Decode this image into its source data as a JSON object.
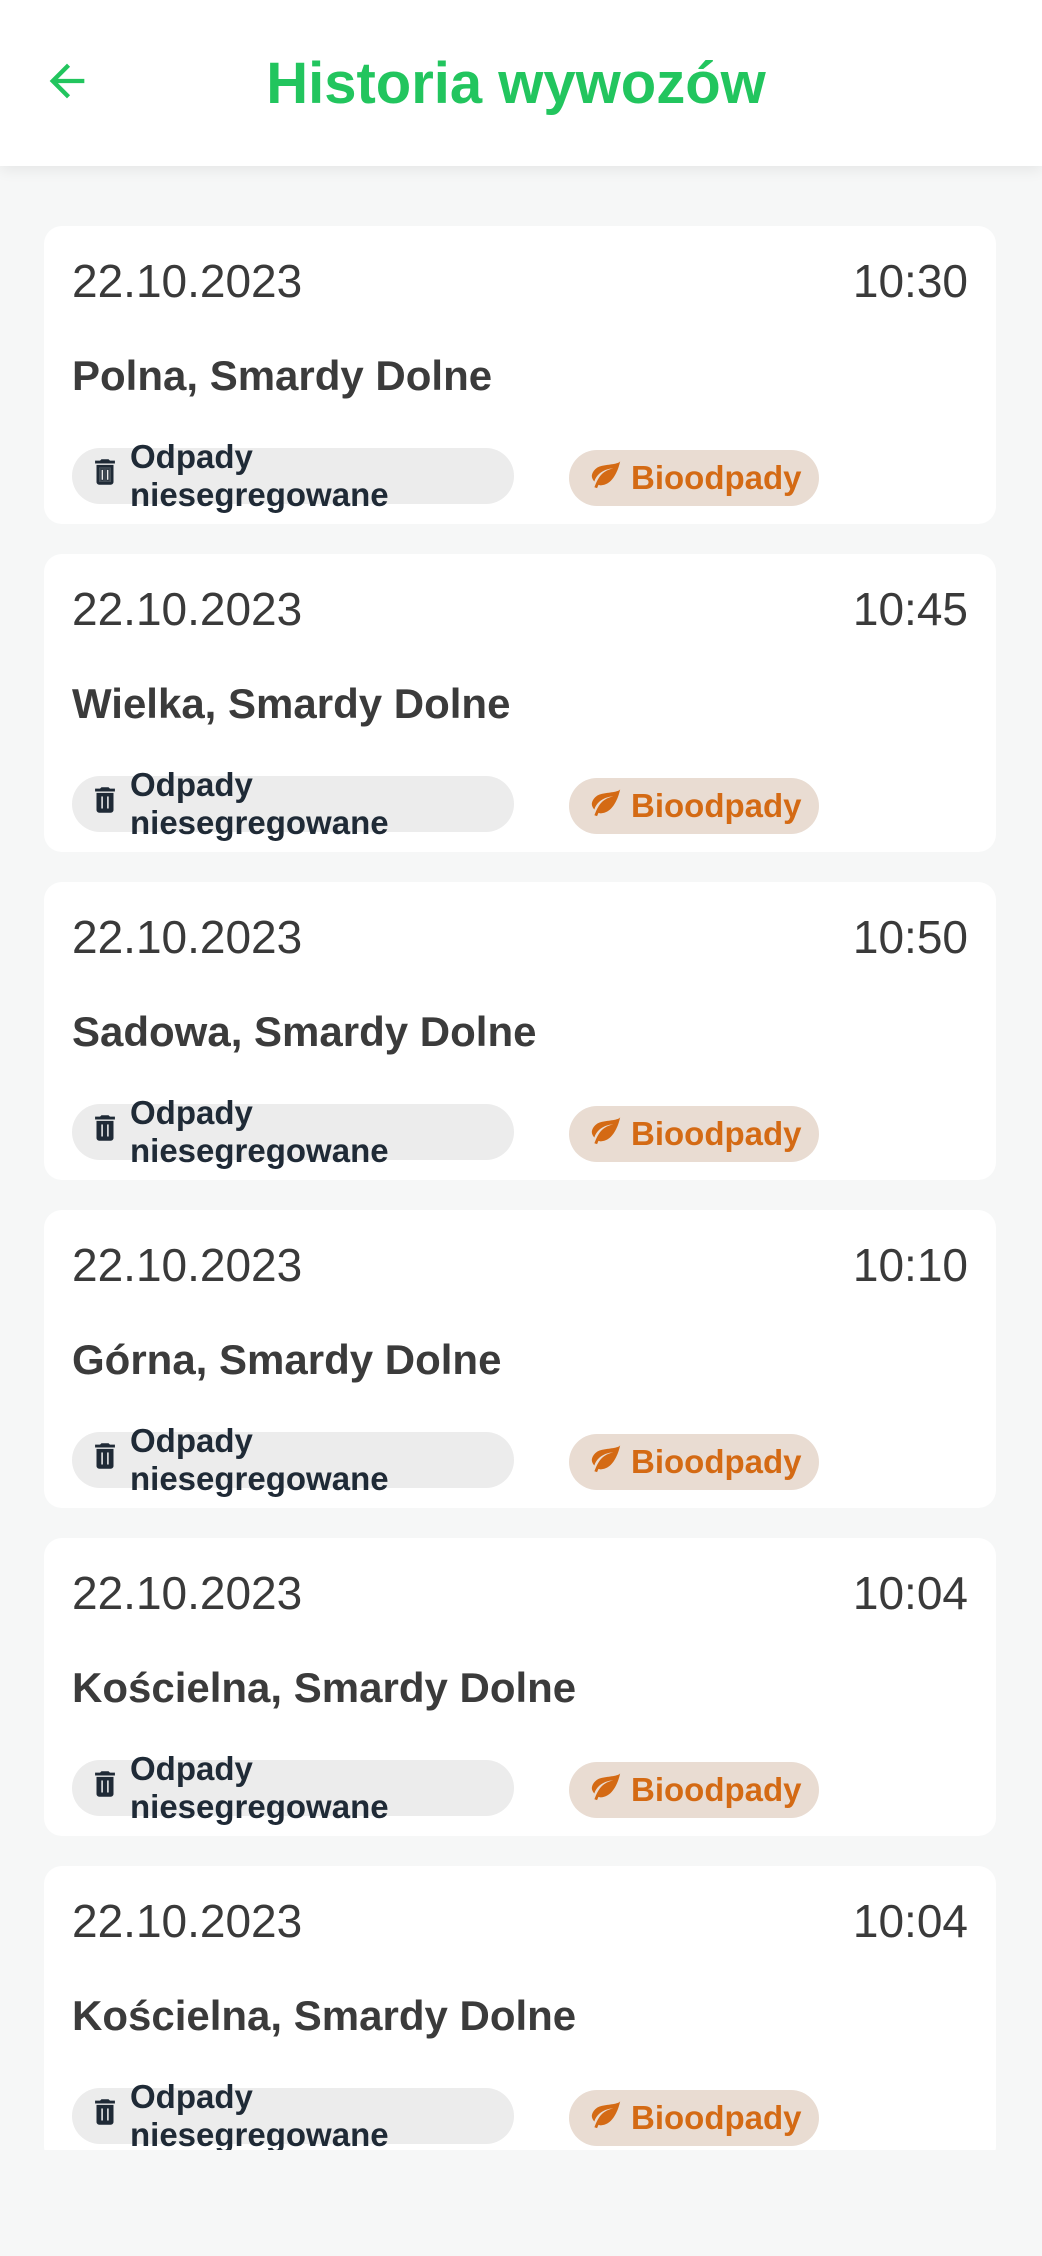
{
  "header": {
    "title": "Historia wywozów",
    "back_icon": "arrow-left-icon"
  },
  "colors": {
    "accent": "#22c55e",
    "bio_text": "#d46a14",
    "bio_bg": "#e9dcd2",
    "mixed_bg": "#ececec"
  },
  "records": [
    {
      "date": "22.10.2023",
      "time": "10:30",
      "address": "Polna, Smardy Dolne",
      "tags": [
        "Odpady niesegregowane",
        "Bioodpady"
      ]
    },
    {
      "date": "22.10.2023",
      "time": "10:45",
      "address": "Wielka, Smardy Dolne",
      "tags": [
        "Odpady niesegregowane",
        "Bioodpady"
      ]
    },
    {
      "date": "22.10.2023",
      "time": "10:50",
      "address": "Sadowa, Smardy Dolne",
      "tags": [
        "Odpady niesegregowane",
        "Bioodpady"
      ]
    },
    {
      "date": "22.10.2023",
      "time": "10:10",
      "address": "Górna, Smardy Dolne",
      "tags": [
        "Odpady niesegregowane",
        "Bioodpady"
      ]
    },
    {
      "date": "22.10.2023",
      "time": "10:04",
      "address": "Kościelna, Smardy Dolne",
      "tags": [
        "Odpady niesegregowane",
        "Bioodpady"
      ]
    },
    {
      "date": "22.10.2023",
      "time": "10:04",
      "address": "Kościelna, Smardy Dolne",
      "tags": [
        "Odpady niesegregowane",
        "Bioodpady"
      ]
    }
  ],
  "icons": {
    "mixed": "trash-icon",
    "bio": "leaf-icon"
  }
}
